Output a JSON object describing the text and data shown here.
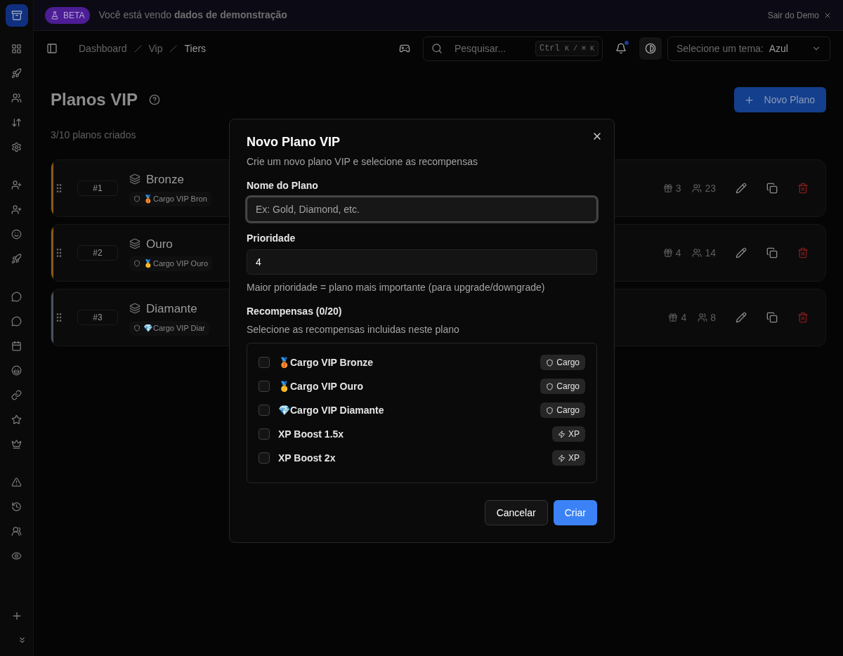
{
  "banner": {
    "badge": "BETA",
    "message": "Você está vendo **dados de demonstração**",
    "exit": "Sair do Demo"
  },
  "breadcrumbs": [
    "Dashboard",
    "Vip",
    "Tiers"
  ],
  "search": {
    "placeholder": "Pesquisar...",
    "shortcut": "Ctrl",
    "shortcut_keys": "K / ⌘ K"
  },
  "notifications": {
    "unread": true
  },
  "theme_select": {
    "label": "Selecione um tema:",
    "value": "Azul"
  },
  "page": {
    "title": "Planos VIP",
    "subtitle": "3/10 planos criados",
    "new_button": "Novo Plano"
  },
  "plans": [
    {
      "rank": "#1",
      "name": "Bronze",
      "reward": "🥉Cargo VIP Bron",
      "rewards_count": "3",
      "members": "23",
      "color": "#8a5a10"
    },
    {
      "rank": "#2",
      "name": "Ouro",
      "reward": "🥇Cargo VIP Ouro",
      "rewards_count": "4",
      "members": "14",
      "color": "#8a5a10"
    },
    {
      "rank": "#3",
      "name": "Diamante",
      "reward": "💎Cargo VIP Diar",
      "rewards_count": "4",
      "members": "8",
      "color": "#4a5260"
    }
  ],
  "dialog": {
    "title": "Novo Plano VIP",
    "description": "Crie um novo plano VIP e selecione as recompensas",
    "name_field": {
      "label": "Nome do Plano",
      "placeholder": "Ex: Gold, Diamond, etc."
    },
    "priority_field": {
      "label": "Prioridade",
      "value": "4",
      "hint": "Maior prioridade = plano mais importante (para upgrade/downgrade)"
    },
    "rewards": {
      "label": "Recompensas (0/20)",
      "description": "Selecione as recompensas incluidas neste plano",
      "items": [
        {
          "label": "🥉Cargo VIP Bronze",
          "checked": false,
          "kind": "role",
          "tag": "Cargo"
        },
        {
          "label": "🥇Cargo VIP Ouro",
          "checked": false,
          "kind": "role",
          "tag": "Cargo"
        },
        {
          "label": "💎Cargo VIP Diamante",
          "checked": false,
          "kind": "role",
          "tag": "Cargo"
        },
        {
          "label": "XP Boost 1.5x",
          "checked": false,
          "kind": "xp",
          "tag": "XP"
        },
        {
          "label": "XP Boost 2x",
          "checked": false,
          "kind": "xp",
          "tag": "XP"
        }
      ]
    },
    "cancel": "Cancelar",
    "create": "Criar"
  }
}
